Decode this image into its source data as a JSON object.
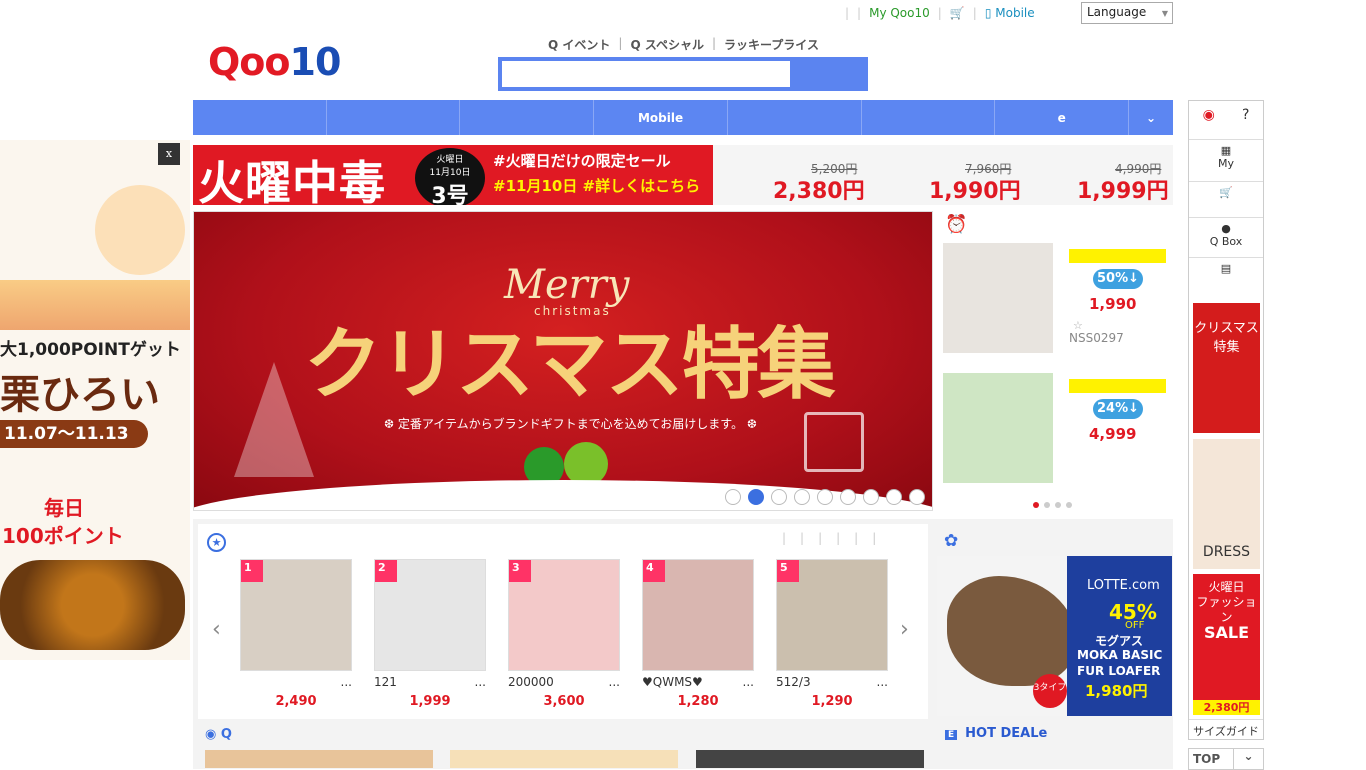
{
  "util": {
    "my_qoo10": "My Qoo10",
    "mobile": "Mobile",
    "language": "Language"
  },
  "logo": {
    "red": "Qoo",
    "blue": "10"
  },
  "search_links": [
    "Q イベント",
    "Q スペシャル",
    "ラッキープライス"
  ],
  "search": {
    "placeholder": ""
  },
  "nav": [
    "",
    "",
    "",
    "Mobile",
    "",
    "",
    "e",
    ""
  ],
  "left_ad": {
    "close": "x",
    "line1": "大1,000POINTゲット",
    "line2": "栗ひろい",
    "dates": "11.07～11.13",
    "line3": "毎日",
    "line4": "100ポイント"
  },
  "banner": {
    "title": "火曜中毒",
    "day": "火曜日",
    "date": "11月10日",
    "issue": "3号",
    "tag1": "#火曜日だけの限定セール",
    "tag2": "#11月10日 #詳しくはこちら",
    "items": [
      {
        "old": "5,200円",
        "new": "2,380円"
      },
      {
        "old": "7,960円",
        "new": "1,990円"
      },
      {
        "old": "4,990円",
        "new": "1,999円"
      }
    ]
  },
  "hero": {
    "merry": "Merry",
    "christmas": "christmas",
    "main": "クリスマス特集",
    "sub": "❆ 定番アイテムからブランドギフトまで心を込めてお届けします。 ❆",
    "slides": 9,
    "active": 1
  },
  "time_deals": [
    {
      "discount": "50%↓",
      "price": "1,990",
      "code": "NSS0297",
      "star": "☆"
    },
    {
      "discount": "24%↓",
      "price": "4,999",
      "code": "",
      "star": ""
    }
  ],
  "products": [
    {
      "rank": "1",
      "name": "",
      "price": "2,490"
    },
    {
      "rank": "2",
      "name": "121",
      "price": "1,999"
    },
    {
      "rank": "3",
      "name": "200000",
      "price": "3,600"
    },
    {
      "rank": "4",
      "name": "♥QWMS♥",
      "price": "1,280"
    },
    {
      "rank": "5",
      "name": "512/3",
      "price": "1,290"
    }
  ],
  "lotte": {
    "brand": "LOTTE.com",
    "pct": "45%",
    "off": "OFF",
    "l1": "モグアス",
    "l2": "MOKA BASIC",
    "l3": "FUR LOAFER",
    "price": "1,980円",
    "badge": "3タイプ"
  },
  "hot_deal": "HOT DEALe",
  "q_label": "Q",
  "sidebar": {
    "my": "My",
    "qbox": "Q Box",
    "xmas": "クリスマス特集",
    "dress": "DRESS",
    "fashion1": "火曜日",
    "fashion2": "ファッション",
    "fashion3": "SALE",
    "fashion_price": "2,380円",
    "size_guide": "サイズガイド",
    "top": "TOP"
  },
  "colors": {
    "red": "#e01923",
    "blue": "#5c86f2",
    "green": "#2a9a2a"
  }
}
